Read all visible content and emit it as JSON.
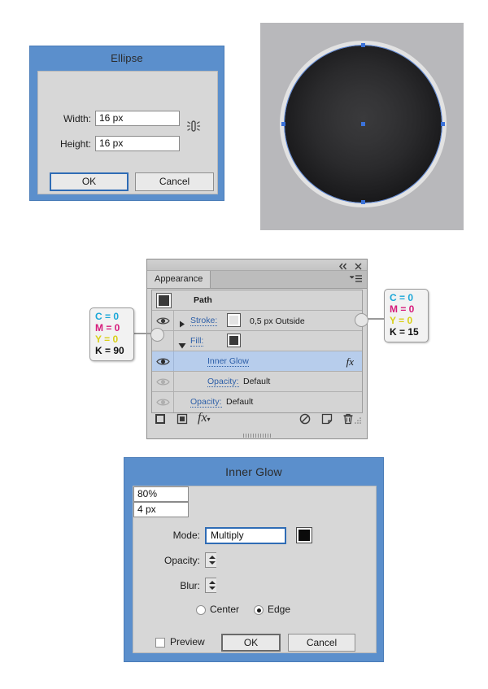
{
  "ellipse_dialog": {
    "title": "Ellipse",
    "fields": [
      {
        "label": "Width:",
        "value": "16 px"
      },
      {
        "label": "Height:",
        "value": "16 px"
      }
    ],
    "link_icon": "constrain-proportions-icon",
    "ok_label": "OK",
    "cancel_label": "Cancel"
  },
  "artwork": {
    "name": "ellipse-artwork-preview",
    "canvas_bg": "#b8b8bb",
    "ring_color": "#e2e2e2",
    "fill_center": "#3a3a3c",
    "fill_edge": "#0d0d0f",
    "anchor_color": "#3b72d9",
    "anchor_count": 4,
    "center_point": true
  },
  "appearance_panel": {
    "tab_label": "Appearance",
    "collapse_icon": "collapse-panel-icon",
    "close_icon": "close-icon",
    "menu_icon": "panel-menu-icon",
    "rows": [
      {
        "id": "path",
        "label": "Path",
        "swatch": "#3a3a3a",
        "eye": "none"
      },
      {
        "id": "stroke",
        "label": "Stroke:",
        "swatch": "#e3e3e3",
        "value": "0,5 px  Outside",
        "eye": "visible",
        "disclosure": "collapsed"
      },
      {
        "id": "fill",
        "label": "Fill:",
        "swatch": "#3a3a3a",
        "value": "",
        "eye": "callout-knob",
        "disclosure": "expanded"
      },
      {
        "id": "inner-glow",
        "label": "Inner Glow",
        "eye": "visible",
        "fx": "fx",
        "selected": true,
        "indent": 2
      },
      {
        "id": "fill-opacity",
        "label": "Opacity:",
        "value": "Default",
        "eye": "dimmed",
        "indent": 2
      },
      {
        "id": "object-opacity",
        "label": "Opacity:",
        "value": "Default",
        "eye": "dimmed",
        "indent": 1
      }
    ],
    "footer_icons": [
      "add-new-stroke-icon",
      "add-new-fill-icon",
      "add-new-effect-icon",
      "clear-appearance-icon",
      "duplicate-item-icon",
      "delete-item-icon",
      "resize-grip-icon"
    ]
  },
  "callouts": {
    "fill_color": {
      "name": "fill-color-callout",
      "lines": [
        "C = 0",
        "M = 0",
        "Y = 0",
        "K = 90"
      ]
    },
    "stroke_color": {
      "name": "stroke-color-callout",
      "lines": [
        "C = 0",
        "M = 0",
        "Y = 0",
        "K = 15"
      ]
    }
  },
  "inner_glow_dialog": {
    "title": "Inner Glow",
    "mode_label": "Mode:",
    "mode_value": "Multiply",
    "mode_color_swatch": "#0b0b0b",
    "opacity_label": "Opacity:",
    "opacity_value": "80%",
    "blur_label": "Blur:",
    "blur_value": "4 px",
    "radio_center": "Center",
    "radio_edge": "Edge",
    "radio_selected": "Edge",
    "preview_label": "Preview",
    "preview_checked": false,
    "ok_label": "OK",
    "cancel_label": "Cancel"
  }
}
